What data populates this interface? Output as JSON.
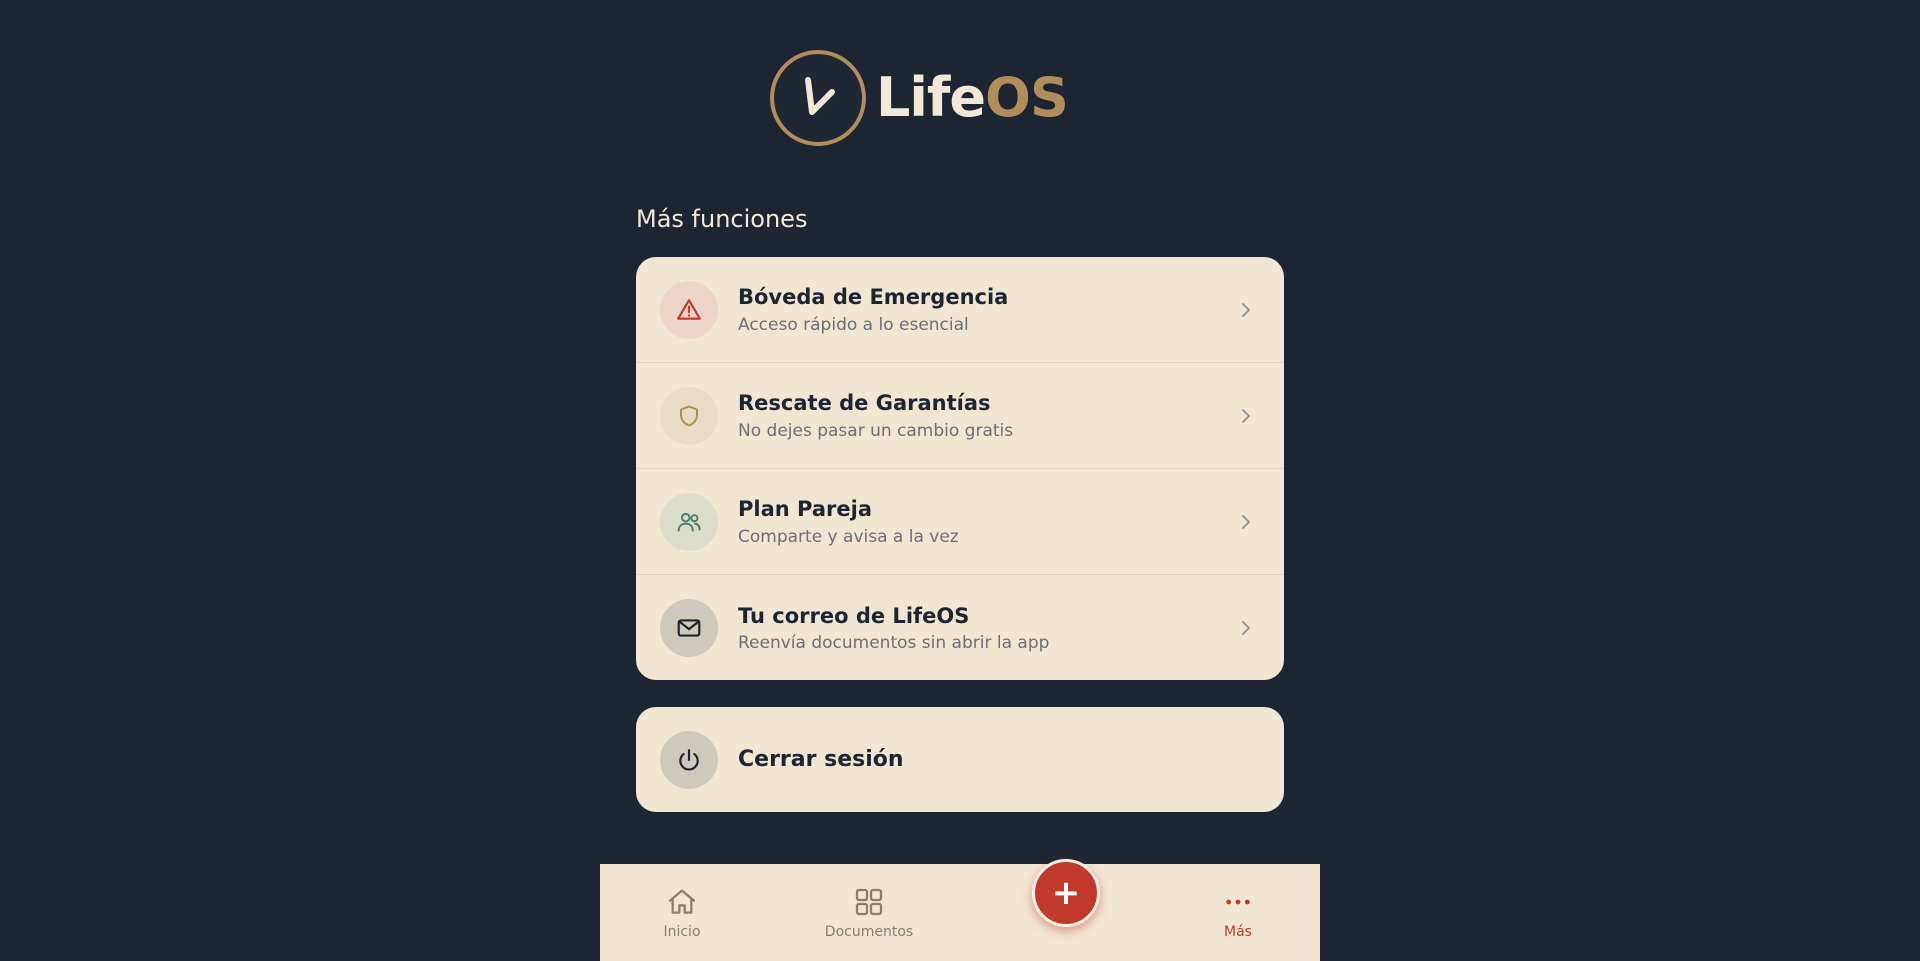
{
  "brand": {
    "life": "Life",
    "os": "OS"
  },
  "section_title": "Más funciones",
  "menu": [
    {
      "title": "Bóveda de Emergencia",
      "subtitle": "Acceso rápido a lo esencial",
      "icon": "warning-triangle-icon",
      "icon_color": "#c0392b",
      "icon_bg": "#ecd5c8"
    },
    {
      "title": "Rescate de Garantías",
      "subtitle": "No dejes pasar un cambio gratis",
      "icon": "shield-icon",
      "icon_color": "#b08d5a",
      "icon_bg": "#e9dcc6"
    },
    {
      "title": "Plan Pareja",
      "subtitle": "Comparte y avisa a la vez",
      "icon": "users-icon",
      "icon_color": "#4f7d6a",
      "icon_bg": "#dcdccb"
    },
    {
      "title": "Tu correo de LifeOS",
      "subtitle": "Reenvía documentos sin abrir la app",
      "icon": "mail-icon",
      "icon_color": "#1e2532",
      "icon_bg": "#cfc9bb"
    }
  ],
  "logout": {
    "label": "Cerrar sesión",
    "icon": "power-icon"
  },
  "nav": {
    "home": "Inicio",
    "documents": "Documentos",
    "add": "+",
    "more": "Más"
  },
  "colors": {
    "background": "#1e2532",
    "card": "#f1e6d2",
    "accent": "#c0392b",
    "gold": "#b08d5a"
  }
}
